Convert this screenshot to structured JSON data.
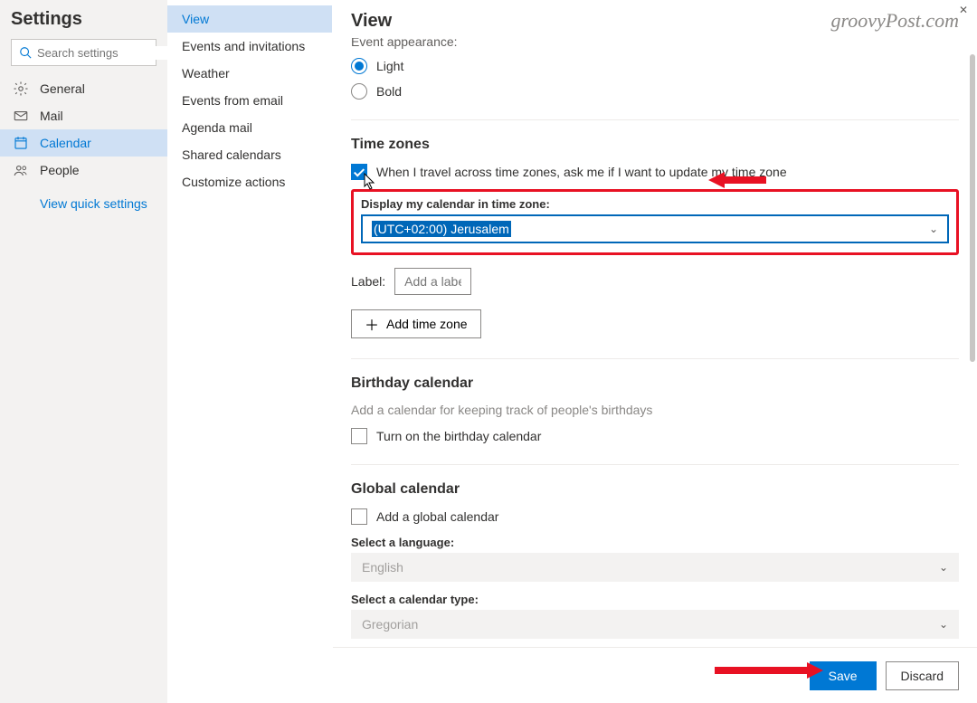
{
  "sidebar": {
    "title": "Settings",
    "search_placeholder": "Search settings",
    "items": [
      {
        "icon": "gear-icon",
        "label": "General"
      },
      {
        "icon": "mail-icon",
        "label": "Mail"
      },
      {
        "icon": "calendar-icon",
        "label": "Calendar",
        "active": true
      },
      {
        "icon": "people-icon",
        "label": "People"
      }
    ],
    "quick_link": "View quick settings"
  },
  "subnav": {
    "items": [
      {
        "label": "View",
        "active": true
      },
      {
        "label": "Events and invitations"
      },
      {
        "label": "Weather"
      },
      {
        "label": "Events from email"
      },
      {
        "label": "Agenda mail"
      },
      {
        "label": "Shared calendars"
      },
      {
        "label": "Customize actions"
      }
    ]
  },
  "header": {
    "title": "View",
    "watermark": "groovyPost.com"
  },
  "appearance": {
    "cutoff_heading": "Event appearance:",
    "options": {
      "light": "Light",
      "bold": "Bold"
    },
    "selected": "light"
  },
  "timezones": {
    "heading": "Time zones",
    "travel_checkbox_label": "When I travel across time zones, ask me if I want to update my time zone",
    "travel_checked": true,
    "display_label": "Display my calendar in time zone:",
    "selected_tz": "(UTC+02:00) Jerusalem",
    "label_label": "Label:",
    "label_placeholder": "Add a label",
    "add_button": "Add time zone"
  },
  "birthday": {
    "heading": "Birthday calendar",
    "subtext": "Add a calendar for keeping track of people's birthdays",
    "checkbox_label": "Turn on the birthday calendar",
    "checked": false
  },
  "global": {
    "heading": "Global calendar",
    "checkbox_label": "Add a global calendar",
    "checked": false,
    "language_label": "Select a language:",
    "language_value": "English",
    "caltype_label": "Select a calendar type:",
    "caltype_value": "Gregorian"
  },
  "footer": {
    "save": "Save",
    "discard": "Discard"
  }
}
